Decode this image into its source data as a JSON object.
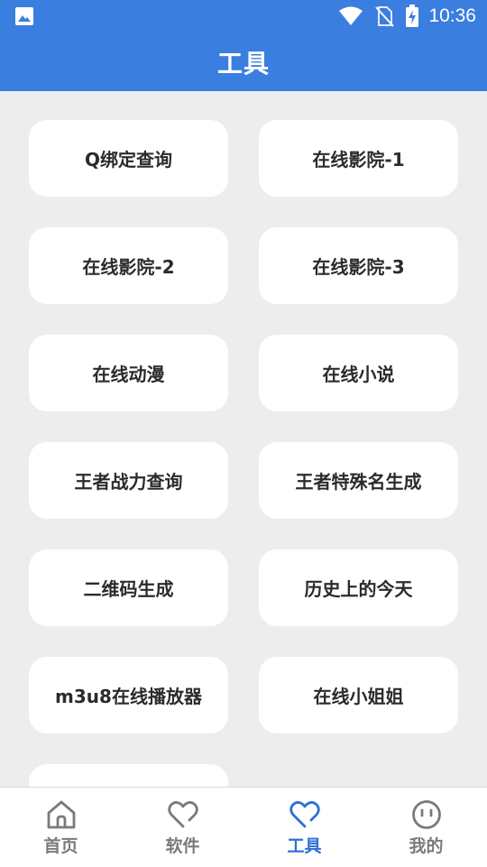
{
  "status_bar": {
    "time": "10:36",
    "icons": [
      "gallery-icon",
      "wifi-icon",
      "no-sim-icon",
      "battery-charging-icon"
    ]
  },
  "app_bar": {
    "title": "工具"
  },
  "tools": [
    {
      "label": "Q绑定查询"
    },
    {
      "label": "在线影院-1"
    },
    {
      "label": "在线影院-2"
    },
    {
      "label": "在线影院-3"
    },
    {
      "label": "在线动漫"
    },
    {
      "label": "在线小说"
    },
    {
      "label": "王者战力查询"
    },
    {
      "label": "王者特殊名生成"
    },
    {
      "label": "二维码生成"
    },
    {
      "label": "历史上的今天"
    },
    {
      "label": "m3u8在线播放器"
    },
    {
      "label": "在线小姐姐"
    },
    {
      "label": ""
    }
  ],
  "tab_bar": {
    "tabs": [
      {
        "label": "首页",
        "icon": "home-icon",
        "active": false
      },
      {
        "label": "软件",
        "icon": "heart-icon",
        "active": false
      },
      {
        "label": "工具",
        "icon": "heart-icon",
        "active": true
      },
      {
        "label": "我的",
        "icon": "face-icon",
        "active": false
      }
    ]
  },
  "colors": {
    "primary": "#3a7ee0",
    "active_tab": "#2f6fd6",
    "inactive_tab": "#7a7a7a",
    "background": "#ededed",
    "card": "#ffffff"
  }
}
